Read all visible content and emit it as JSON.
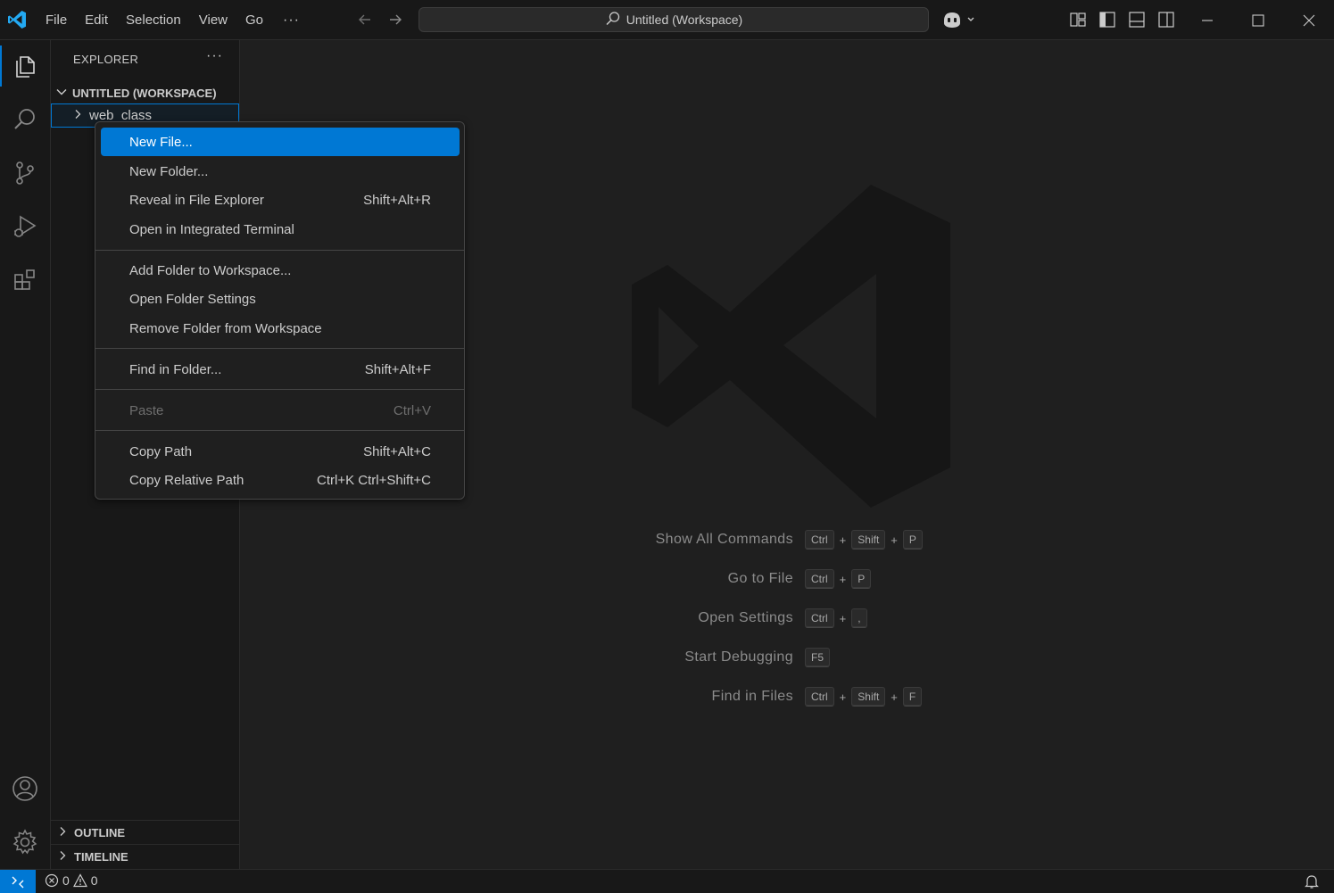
{
  "titlebar": {
    "menu": [
      "File",
      "Edit",
      "Selection",
      "View",
      "Go"
    ],
    "more": "···",
    "command_center": "Untitled (Workspace)",
    "logo_icon": "vscode-logo"
  },
  "activity_bar": {
    "items": [
      "explorer-icon",
      "search-icon",
      "source-control-icon",
      "run-debug-icon",
      "extensions-icon"
    ],
    "bottom": [
      "account-icon",
      "settings-gear-icon"
    ]
  },
  "sidebar": {
    "header": "EXPLORER",
    "more": "···",
    "workspace_title": "UNTITLED (WORKSPACE)",
    "folder": "web_class",
    "outline": "OUTLINE",
    "timeline": "TIMELINE"
  },
  "context_menu": {
    "items": [
      {
        "label": "New File...",
        "shortcut": ""
      },
      {
        "label": "New Folder...",
        "shortcut": ""
      },
      {
        "label": "Reveal in File Explorer",
        "shortcut": "Shift+Alt+R"
      },
      {
        "label": "Open in Integrated Terminal",
        "shortcut": ""
      },
      {
        "label": "Add Folder to Workspace...",
        "shortcut": ""
      },
      {
        "label": "Open Folder Settings",
        "shortcut": ""
      },
      {
        "label": "Remove Folder from Workspace",
        "shortcut": ""
      },
      {
        "label": "Find in Folder...",
        "shortcut": "Shift+Alt+F"
      },
      {
        "label": "Paste",
        "shortcut": "Ctrl+V"
      },
      {
        "label": "Copy Path",
        "shortcut": "Shift+Alt+C"
      },
      {
        "label": "Copy Relative Path",
        "shortcut": "Ctrl+K Ctrl+Shift+C"
      }
    ]
  },
  "editor": {
    "shortcuts": [
      {
        "label": "Show All Commands",
        "keys": [
          "Ctrl",
          "Shift",
          "P"
        ]
      },
      {
        "label": "Go to File",
        "keys": [
          "Ctrl",
          "P"
        ]
      },
      {
        "label": "Open Settings",
        "keys": [
          "Ctrl",
          ","
        ]
      },
      {
        "label": "Start Debugging",
        "keys": [
          "F5"
        ]
      },
      {
        "label": "Find in Files",
        "keys": [
          "Ctrl",
          "Shift",
          "F"
        ]
      }
    ],
    "plus": "+"
  },
  "statusbar": {
    "errors": "0",
    "warnings": "0"
  },
  "colors": {
    "accent": "#0078d4",
    "background": "#1f1f1f",
    "chrome": "#181818"
  }
}
